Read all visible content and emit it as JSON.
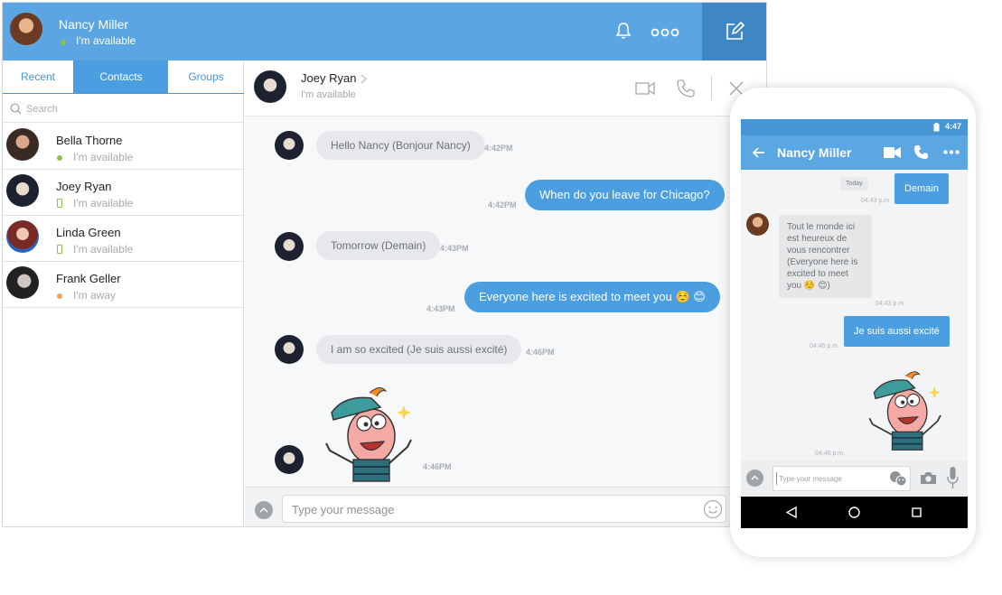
{
  "user": {
    "name": "Nancy Miller",
    "status": "I'm available"
  },
  "tabs": [
    {
      "label": "Recent"
    },
    {
      "label": "Contacts"
    },
    {
      "label": "Groups"
    }
  ],
  "search": {
    "placeholder": "Search"
  },
  "contacts": [
    {
      "name": "Bella Thorne",
      "status": "I'm available",
      "indicator": "online-dot"
    },
    {
      "name": "Joey Ryan",
      "status": "I'm available",
      "indicator": "mobile"
    },
    {
      "name": "Linda Green",
      "status": "I'm available",
      "indicator": "mobile"
    },
    {
      "name": "Frank Geller",
      "status": "I'm away",
      "indicator": "away-dot"
    }
  ],
  "chat": {
    "name": "Joey Ryan",
    "status": "I'm available",
    "messages": [
      {
        "direction": "in",
        "text": "Hello Nancy (Bonjour Nancy)",
        "time": "4:42PM"
      },
      {
        "direction": "out",
        "text": "When do you leave for Chicago?",
        "time": "4:42PM"
      },
      {
        "direction": "in",
        "text": "Tomorrow (Demain)",
        "time": "4:43PM"
      },
      {
        "direction": "out",
        "text": "Everyone here is excited to meet you ☺️ 😊",
        "time": "4:43PM"
      },
      {
        "direction": "in",
        "text": "I am so excited (Je suis aussi excité)",
        "time": "4:46PM"
      },
      {
        "direction": "in",
        "type": "sticker",
        "time": "4:46PM"
      }
    ],
    "input_placeholder": "Type your message"
  },
  "phone": {
    "clock": "4:47",
    "title": "Nancy Miller",
    "day_label": "Today",
    "messages": [
      {
        "direction": "out",
        "text": "Demain",
        "time": "04:43 p.m."
      },
      {
        "direction": "in",
        "text": "Tout le monde ici est heureux de vous rencontrer (Everyone here is excited to meet you ☺️ 😊)",
        "time": "04:43 p.m."
      },
      {
        "direction": "out",
        "text": "Je suis aussi excité",
        "time": "04:46 p.m."
      },
      {
        "direction": "in",
        "type": "sticker",
        "time": "04:46 p.m."
      }
    ],
    "input_placeholder": "Type your message"
  },
  "colors": {
    "brand": "#5aa5e2",
    "brand_dark": "#3f86c5",
    "bubble_out": "#4b9fe1",
    "bubble_in": "#e6e8eb",
    "online": "#8bc34a",
    "away": "#f0a64a"
  }
}
